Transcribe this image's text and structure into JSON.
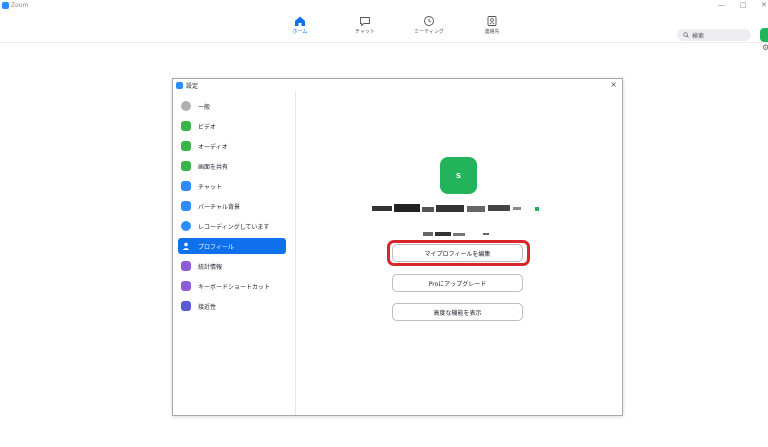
{
  "window": {
    "app_title": "Zoom",
    "minimize": "—",
    "maximize": "□",
    "close": "✕"
  },
  "topnav": {
    "items": [
      {
        "label": "ホーム",
        "icon": "home-icon",
        "active": true
      },
      {
        "label": "チャット",
        "icon": "chat-icon"
      },
      {
        "label": "ミーティング",
        "icon": "clock-icon"
      },
      {
        "label": "連絡先",
        "icon": "contacts-icon"
      }
    ],
    "search_label": "検索"
  },
  "settings": {
    "title": "設定",
    "close": "×",
    "sidebar": [
      {
        "label": "一般",
        "icon": "general-icon",
        "color": "#b0b0b0"
      },
      {
        "label": "ビデオ",
        "icon": "video-icon",
        "color": "#3cb34a"
      },
      {
        "label": "オーディオ",
        "icon": "audio-icon",
        "color": "#3cb34a"
      },
      {
        "label": "画面を共有",
        "icon": "share-screen-icon",
        "color": "#3cb34a"
      },
      {
        "label": "チャット",
        "icon": "chat-icon",
        "color": "#2d8cff"
      },
      {
        "label": "バーチャル背景",
        "icon": "virtual-background-icon",
        "color": "#2d8cff"
      },
      {
        "label": "レコーディングしています",
        "icon": "recording-icon",
        "color": "#2d8cff"
      },
      {
        "label": "プロフィール",
        "icon": "profile-icon",
        "color": "#ffffff",
        "active": true
      },
      {
        "label": "統計情報",
        "icon": "statistics-icon",
        "color": "#8e5cd9"
      },
      {
        "label": "キーボードショートカット",
        "icon": "keyboard-icon",
        "color": "#8e5cd9"
      },
      {
        "label": "接近性",
        "icon": "accessibility-icon",
        "color": "#5a5ad6"
      }
    ],
    "profile": {
      "avatar_letter": "S",
      "edit_button": "マイプロフィールを編集",
      "upgrade_button": "Proにアップグレード",
      "advanced_button": "高度な機能を表示"
    }
  },
  "colors": {
    "accent": "#0e71eb",
    "avatar": "#23b35a",
    "highlight": "#d9262b"
  }
}
